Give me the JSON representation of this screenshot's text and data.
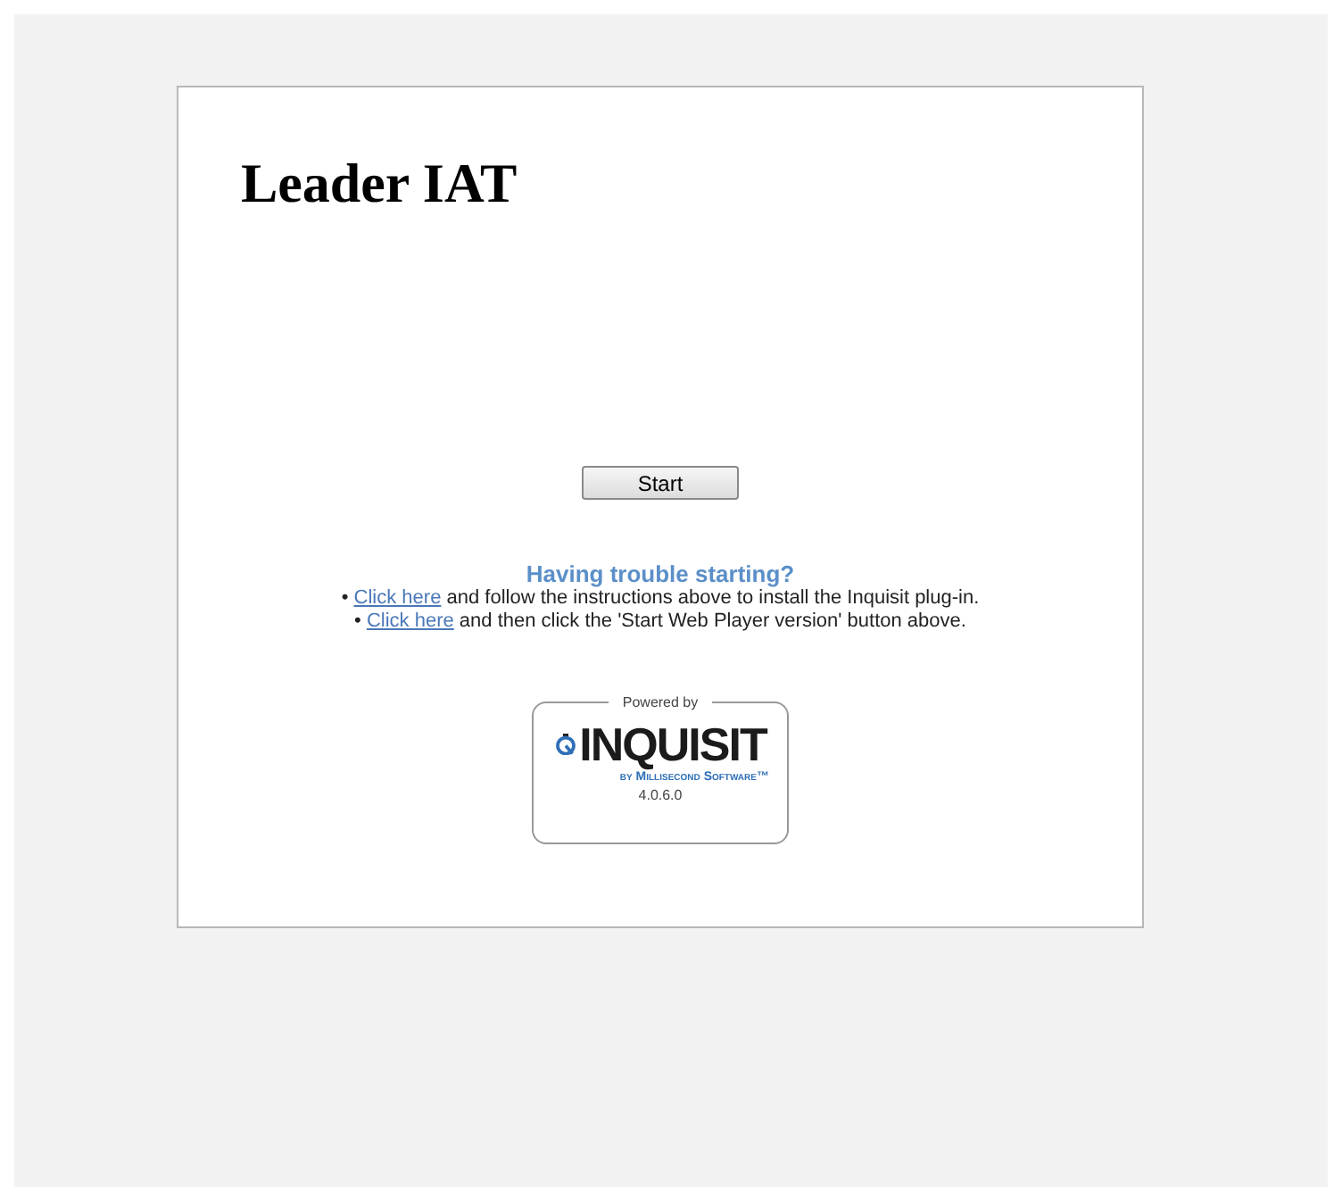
{
  "title": "Leader IAT",
  "start_button": "Start",
  "help": {
    "heading": "Having trouble starting?",
    "lines": [
      {
        "bullet": "•",
        "link": "Click here",
        "text": "and follow the instructions above to install the Inquisit plug-in."
      },
      {
        "bullet": "•",
        "link": "Click here",
        "text": "and then click the 'Start Web Player version' button above."
      }
    ]
  },
  "badge": {
    "caption": "Powered by",
    "logo": "INQUISIT",
    "maker": "by Millisecond Software™",
    "version": "4.0.6.0"
  }
}
